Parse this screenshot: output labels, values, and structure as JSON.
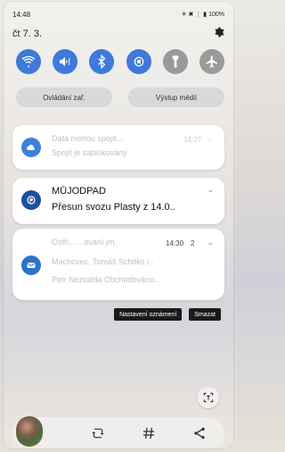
{
  "status_bar": {
    "time": "14:48",
    "indicators": "✳ ✖ ⋮ ▮ 100%"
  },
  "date": "čt 7. 3.",
  "quick_toggles": [
    {
      "name": "wifi-icon",
      "state": "on"
    },
    {
      "name": "sound-icon",
      "state": "on"
    },
    {
      "name": "bluetooth-icon",
      "state": "on"
    },
    {
      "name": "autorotate-icon",
      "state": "on"
    },
    {
      "name": "flashlight-icon",
      "state": "off"
    },
    {
      "name": "airplane-icon",
      "state": "off"
    }
  ],
  "pills": {
    "device_control": "Ovládání zař.",
    "media_output": "Výstup médií"
  },
  "notifications": [
    {
      "title": "Data mohou spojit...",
      "body": "Spojit je zablokováný",
      "time": "14:27"
    },
    {
      "app": "MŮJODPAD",
      "body": "Přesun svozu Plasty z 14.0.."
    },
    {
      "title": "Ostři... ...ování jm.",
      "line2": "Machovec, Tomáš Schöks i...",
      "line3": "Petr Nezvalda Obchodováno...",
      "time": "14:30",
      "count": "2"
    }
  ],
  "actions": {
    "settings": "Nastavení oznámení",
    "clear": "Smazat"
  },
  "colors": {
    "toggle_on": "#3e7ad9",
    "toggle_off": "#9a9a9a"
  }
}
